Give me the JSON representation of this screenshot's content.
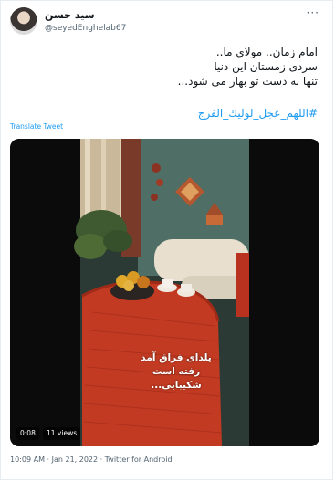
{
  "author": {
    "name": "سید حسن",
    "handle": "@seyedEnghelab67"
  },
  "icons": {
    "more": "more-dots-icon"
  },
  "tweet": {
    "lines": [
      "امام زمان.. مولای ما..",
      "سردی زمستان این دنیا",
      "تنها به دست تو بهار می شود..."
    ],
    "hashtag": "#اللهم_عجل_لولیك_الفرج",
    "translate_label": "Translate Tweet"
  },
  "media": {
    "overlay_lines": [
      "یلدای فراق آمد",
      "رفته است شکیبایی..."
    ],
    "duration": "0:08",
    "views": "11 views"
  },
  "meta": {
    "timestamp": "10:09 AM · Jan 21, 2022 · Twitter for Android"
  },
  "colors": {
    "accent": "#1d9bf0",
    "muted": "#536471",
    "border": "#e6ecf0"
  }
}
